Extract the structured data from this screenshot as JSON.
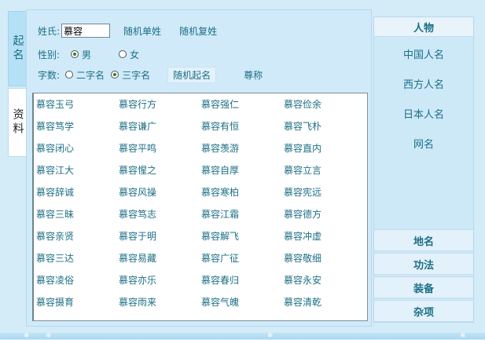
{
  "tabs": {
    "naming": "起名",
    "reference": "资料"
  },
  "form": {
    "surname_label": "姓氏:",
    "surname_value": "慕容",
    "random_single_surname": "随机单姓",
    "random_compound_surname": "随机复姓",
    "gender_label": "性别:",
    "gender_options": [
      {
        "label": "男",
        "selected": true
      },
      {
        "label": "女",
        "selected": false
      }
    ],
    "length_label": "字数:",
    "length_options": [
      {
        "label": "二字名",
        "selected": false
      },
      {
        "label": "三字名",
        "selected": true
      }
    ],
    "generate_button": "随机起名",
    "honorific_link": "尊称"
  },
  "names": [
    "慕容玉弓",
    "慕容行方",
    "慕容强仁",
    "慕容俭余",
    "慕容笃学",
    "慕容谦广",
    "慕容有恒",
    "慕容飞朴",
    "慕容闭心",
    "慕容平鸣",
    "慕容羡游",
    "慕容直内",
    "慕容江大",
    "慕容惺之",
    "慕容自厚",
    "慕容立言",
    "慕容辞诚",
    "慕容风操",
    "慕容寒柏",
    "慕容宪远",
    "慕容三昧",
    "慕容笃志",
    "慕容江霜",
    "慕容德方",
    "慕容亲贤",
    "慕容于明",
    "慕容解飞",
    "慕容冲虚",
    "慕容三达",
    "慕容易藏",
    "慕容广征",
    "慕容敬细",
    "慕容凌俗",
    "慕容亦乐",
    "慕容春归",
    "慕容永安",
    "慕容摄育",
    "慕容雨来",
    "慕容气魄",
    "慕容清乾"
  ],
  "sidebar": {
    "header": "人物",
    "items": [
      "中国人名",
      "西方人名",
      "日本人名",
      "网名"
    ],
    "categories": [
      "地名",
      "功法",
      "装备",
      "杂项"
    ]
  }
}
